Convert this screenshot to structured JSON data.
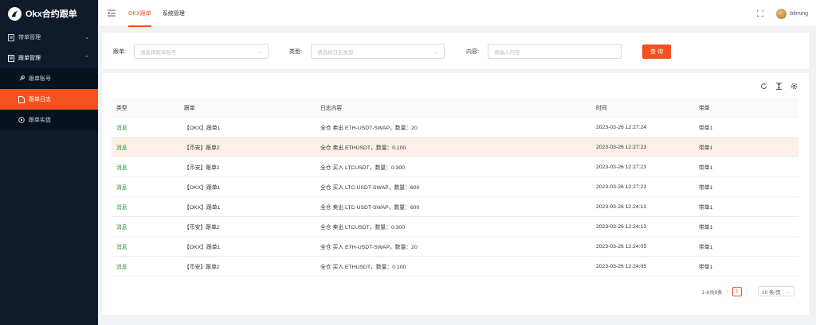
{
  "app": {
    "title": "Okx合约跟单"
  },
  "sidebar": {
    "groups": [
      {
        "label": "带单管理",
        "icon": "document-icon",
        "expanded": false
      },
      {
        "label": "跟单管理",
        "icon": "document-icon",
        "expanded": true,
        "children": [
          {
            "label": "跟单账号",
            "icon": "link-icon"
          },
          {
            "label": "跟单日志",
            "icon": "file-icon",
            "active": true
          },
          {
            "label": "跟单实盘",
            "icon": "circle-icon"
          }
        ]
      }
    ]
  },
  "header": {
    "tabs": [
      {
        "label": "OKX跟单",
        "active": true
      },
      {
        "label": "系统管理"
      }
    ],
    "username": "bitming"
  },
  "filters": {
    "follow": {
      "label": "跟单:",
      "placeholder": "请选择跟单账号"
    },
    "type": {
      "label": "类型:",
      "placeholder": "请选择日志类型"
    },
    "content": {
      "label": "内容:",
      "placeholder": "请输入内容"
    },
    "search_label": "查 询"
  },
  "table": {
    "columns": [
      "类型",
      "跟单",
      "日志内容",
      "时间",
      "带单"
    ],
    "rows": [
      [
        "消息",
        "【OKX】跟单1",
        "全仓 卖出 ETH-USDT-SWAP，数量：20",
        "2023-03-26 12:27:24",
        "带单1"
      ],
      [
        "消息",
        "【币安】跟单2",
        "全仓 卖出 ETHUSDT，数量：0.100",
        "2023-03-26 12:27:23",
        "带单1"
      ],
      [
        "消息",
        "【币安】跟单2",
        "全仓 买入 LTCUSDT，数量：0.300",
        "2023-03-26 12:27:23",
        "带单1"
      ],
      [
        "消息",
        "【OKX】跟单1",
        "全仓 买入 LTC-USDT-SWAP，数量：600",
        "2023-03-26 12:27:22",
        "带单1"
      ],
      [
        "消息",
        "【OKX】跟单1",
        "全仓 卖出 LTC-USDT-SWAP，数量：600",
        "2023-03-26 12:24:13",
        "带单1"
      ],
      [
        "消息",
        "【币安】跟单2",
        "全仓 卖出 LTCUSDT，数量：0.300",
        "2023-03-26 12:24:13",
        "带单1"
      ],
      [
        "消息",
        "【OKX】跟单1",
        "全仓 买入 ETH-USDT-SWAP，数量：20",
        "2023-03-26 12:24:05",
        "带单1"
      ],
      [
        "消息",
        "【币安】跟单2",
        "全仓 买入 ETHUSDT，数量：0.100",
        "2023-03-26 12:24:05",
        "带单1"
      ]
    ],
    "highlighted_row": 1
  },
  "pagination": {
    "summary": "1-8共8条",
    "current_page": "1",
    "page_size": "10 条/页"
  },
  "colors": {
    "accent": "#f4511e",
    "sidebar_bg": "#0f1a2a",
    "message_type": "#2e8b3a",
    "row_highlight": "#fdf0e8"
  }
}
